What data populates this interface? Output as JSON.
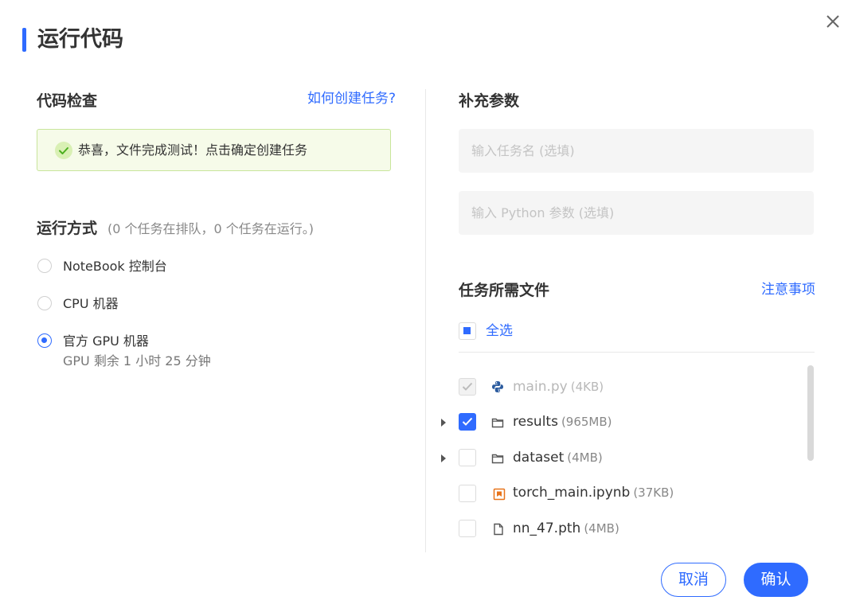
{
  "dialog": {
    "title": "运行代码"
  },
  "code_check": {
    "heading": "代码检查",
    "help_link": "如何创建任务?",
    "success_message": "恭喜，文件完成测试！点击确定创建任务"
  },
  "run_mode": {
    "heading": "运行方式",
    "queue_note": "(0 个任务在排队，0 个任务在运行。)",
    "options": [
      {
        "label": "NoteBook 控制台",
        "selected": false
      },
      {
        "label": "CPU 机器",
        "selected": false
      },
      {
        "label": "官方 GPU 机器",
        "sub": "GPU 剩余 1 小时 25 分钟",
        "selected": true
      }
    ]
  },
  "extra_params": {
    "heading": "补充参数",
    "task_name_placeholder": "输入任务名 (选填)",
    "python_params_placeholder": "输入 Python 参数 (选填)"
  },
  "files": {
    "heading": "任务所需文件",
    "notes_link": "注意事项",
    "select_all_label": "全选",
    "items": [
      {
        "name": "main.py",
        "size": "(4KB)",
        "icon": "python-icon",
        "checked": true,
        "disabled": true,
        "expandable": false
      },
      {
        "name": "results",
        "size": "(965MB)",
        "icon": "folder-icon",
        "checked": true,
        "disabled": false,
        "expandable": true
      },
      {
        "name": "dataset",
        "size": "(4MB)",
        "icon": "folder-icon",
        "checked": false,
        "disabled": false,
        "expandable": true
      },
      {
        "name": "torch_main.ipynb",
        "size": "(37KB)",
        "icon": "notebook-icon",
        "checked": false,
        "disabled": false,
        "expandable": false
      },
      {
        "name": "nn_47.pth",
        "size": "(4MB)",
        "icon": "file-icon",
        "checked": false,
        "disabled": false,
        "expandable": false
      }
    ]
  },
  "footer": {
    "cancel_label": "取消",
    "confirm_label": "确认"
  },
  "colors": {
    "accent": "#2f6bff",
    "success_bg": "#f6fbe9",
    "success_border": "#c8e59b"
  }
}
